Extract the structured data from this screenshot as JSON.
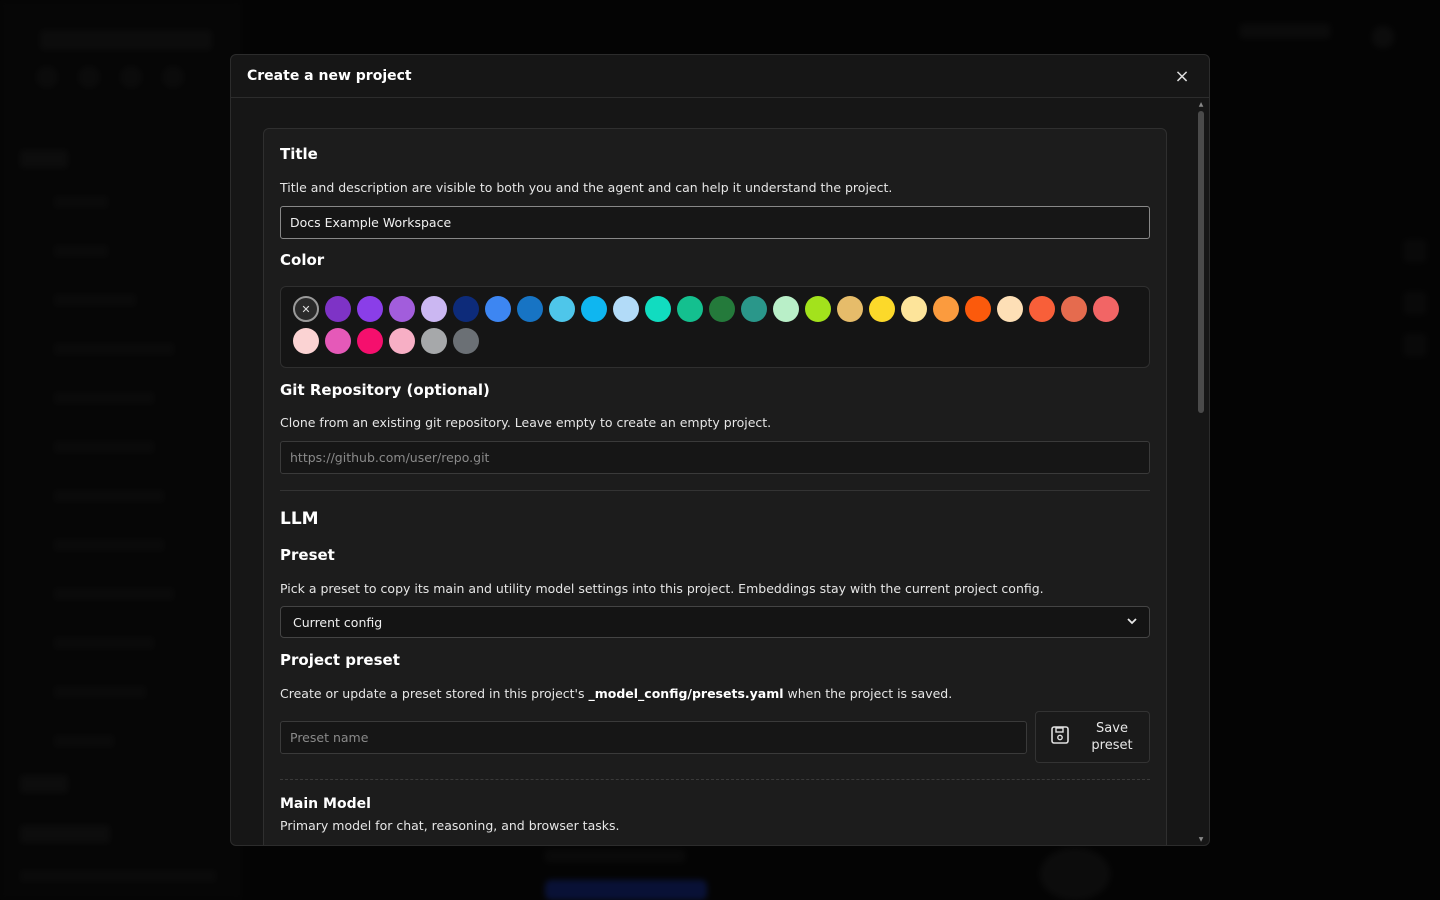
{
  "dialog": {
    "title": "Create a new project",
    "close_icon": "×"
  },
  "title_section": {
    "heading": "Title",
    "description": "Title and description are visible to both you and the agent and can help it understand the project.",
    "value": "Docs Example Workspace"
  },
  "color_section": {
    "heading": "Color",
    "none_glyph": "✕",
    "row1": [
      "#7e33c6",
      "#8a3ee8",
      "#a25ddc",
      "#cbb7f2",
      "#0d2b7a",
      "#3d86f2",
      "#1774c4",
      "#4ec6ea",
      "#0fb6f0",
      "#b2dbf8",
      "#11dcc0",
      "#14c08f",
      "#247a3b",
      "#2a978a",
      "#b9efc8",
      "#a3e21c",
      "#e6bc6a",
      "#fcd92a",
      "#fde49a",
      "#fb9b3e",
      "#fb5a0c",
      "#fddfb6",
      "#f85f39",
      "#e56b4e",
      "#f26565"
    ],
    "row2": [
      "#fbd3d3",
      "#e559b8",
      "#f50f6d",
      "#f7afc5",
      "#a6a8aa",
      "#6b7075"
    ]
  },
  "git_section": {
    "heading": "Git Repository (optional)",
    "description": "Clone from an existing git repository. Leave empty to create an empty project.",
    "placeholder": "https://github.com/user/repo.git"
  },
  "llm_section": {
    "heading": "LLM",
    "preset_heading": "Preset",
    "preset_description": "Pick a preset to copy its main and utility model settings into this project. Embeddings stay with the current project config.",
    "preset_value": "Current config",
    "project_preset_heading": "Project preset",
    "project_preset_desc_before": "Create or update a preset stored in this project's ",
    "project_preset_desc_path": "_model_config/presets.yaml",
    "project_preset_desc_after": " when the project is saved.",
    "preset_name_placeholder": "Preset name",
    "save_preset_label": "Save preset",
    "main_model_heading": "Main Model",
    "main_model_description": "Primary model for chat, reasoning, and browser tasks."
  }
}
